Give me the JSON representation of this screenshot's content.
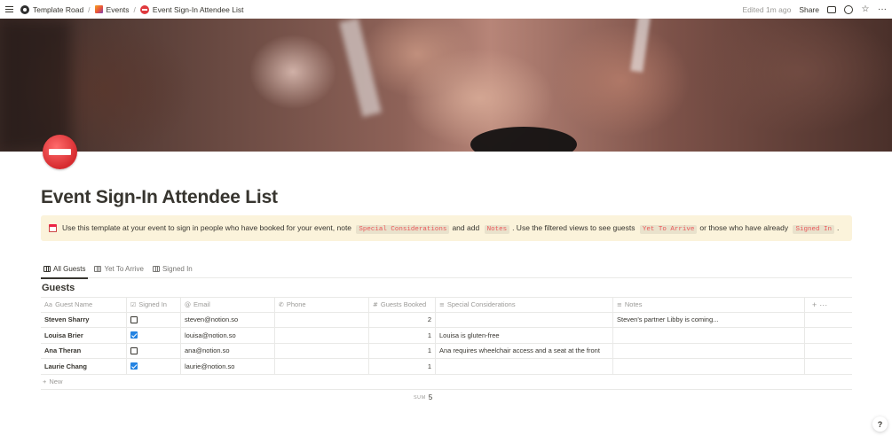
{
  "breadcrumbs": [
    {
      "label": "Template Road",
      "icon": "workspace-icon"
    },
    {
      "label": "Events",
      "icon": "events-emoji-icon"
    },
    {
      "label": "Event Sign-In Attendee List",
      "icon": "no-entry-icon"
    }
  ],
  "topbar": {
    "edited": "Edited 1m ago",
    "share": "Share"
  },
  "page": {
    "title": "Event Sign-In Attendee List",
    "icon": "no-entry-icon"
  },
  "callout": {
    "icon": "calendar-icon",
    "text1": "Use this template at your event to sign in people who have booked for your event, note",
    "code1": "Special Considerations",
    "text2": "and add",
    "code2": "Notes",
    "text3": ". Use the filtered views to see guests",
    "code3": "Yet To Arrive",
    "text4": "or those who have already",
    "code4": "Signed In",
    "text5": "."
  },
  "tabs": [
    {
      "label": "All Guests",
      "active": true
    },
    {
      "label": "Yet To Arrive",
      "active": false
    },
    {
      "label": "Signed In",
      "active": false
    }
  ],
  "database": {
    "title": "Guests",
    "columns": [
      {
        "label": "Guest Name",
        "icon": "Aa"
      },
      {
        "label": "Signed In",
        "icon": "☑"
      },
      {
        "label": "Email",
        "icon": "@"
      },
      {
        "label": "Phone",
        "icon": "✆"
      },
      {
        "label": "Guests Booked",
        "icon": "#"
      },
      {
        "label": "Special Considerations",
        "icon": "≡"
      },
      {
        "label": "Notes",
        "icon": "≡"
      }
    ],
    "rows": [
      {
        "name": "Steven Sharry",
        "signed_in": false,
        "email": "steven@notion.so",
        "phone": "",
        "guests": "2",
        "considerations": "",
        "notes": "Steven's partner Libby is coming..."
      },
      {
        "name": "Louisa Brier",
        "signed_in": true,
        "email": "louisa@notion.so",
        "phone": "",
        "guests": "1",
        "considerations": "Louisa is gluten-free",
        "notes": ""
      },
      {
        "name": "Ana Theran",
        "signed_in": false,
        "email": "ana@notion.so",
        "phone": "",
        "guests": "1",
        "considerations": "Ana requires wheelchair access and a seat at the front",
        "notes": ""
      },
      {
        "name": "Laurie Chang",
        "signed_in": true,
        "email": "laurie@notion.so",
        "phone": "",
        "guests": "1",
        "considerations": "",
        "notes": ""
      }
    ],
    "new_label": "New",
    "sum_label": "SUM",
    "sum_value": "5"
  },
  "help": "?",
  "colors": {
    "callout_bg": "#fbf3db",
    "code_text": "#eb5757",
    "checkbox_checked": "#2383e2",
    "page_icon": "#e0393e"
  }
}
